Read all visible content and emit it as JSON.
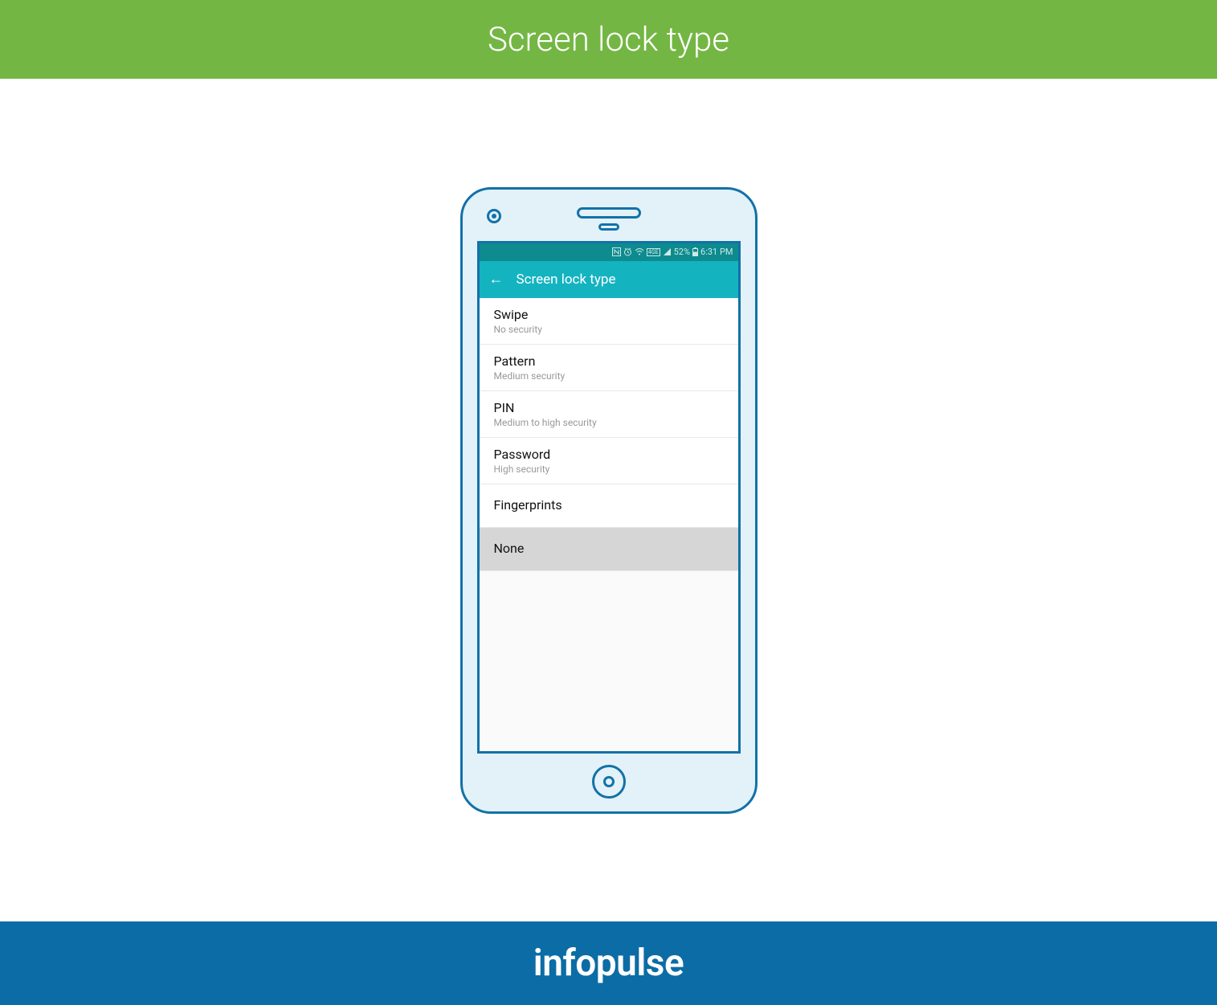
{
  "banner": {
    "title": "Screen lock type"
  },
  "status_bar": {
    "battery_percent": "52%",
    "time": "6:31 PM",
    "network_label": "4GE"
  },
  "app_bar": {
    "title": "Screen lock type"
  },
  "lock_options": [
    {
      "title": "Swipe",
      "subtitle": "No security",
      "selected": false
    },
    {
      "title": "Pattern",
      "subtitle": "Medium security",
      "selected": false
    },
    {
      "title": "PIN",
      "subtitle": "Medium to high security",
      "selected": false
    },
    {
      "title": "Password",
      "subtitle": "High security",
      "selected": false
    },
    {
      "title": "Fingerprints",
      "subtitle": "",
      "selected": false
    },
    {
      "title": "None",
      "subtitle": "",
      "selected": true
    }
  ],
  "footer": {
    "brand": "infopulse"
  }
}
